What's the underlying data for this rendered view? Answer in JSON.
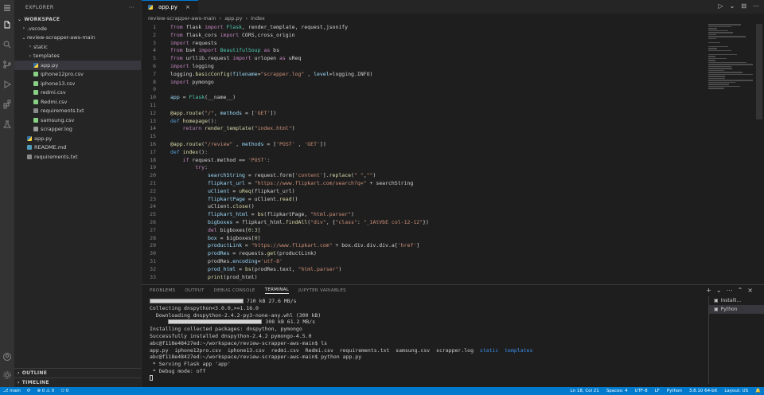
{
  "sidebar": {
    "title": "EXPLORER",
    "workspace": "WORKSPACE",
    "tree": [
      {
        "label": ".vscode",
        "indent": 1,
        "chev": ">",
        "icon": ""
      },
      {
        "label": "review-scrapper-aws-main",
        "indent": 1,
        "chev": "v",
        "icon": ""
      },
      {
        "label": "static",
        "indent": 2,
        "chev": ">",
        "icon": ""
      },
      {
        "label": "templates",
        "indent": 2,
        "chev": ">",
        "icon": ""
      },
      {
        "label": "app.py",
        "indent": 2,
        "chev": "",
        "icon": "py",
        "active": true
      },
      {
        "label": "iphone12pro.csv",
        "indent": 2,
        "chev": "",
        "icon": "csv"
      },
      {
        "label": "iphone13.csv",
        "indent": 2,
        "chev": "",
        "icon": "csv"
      },
      {
        "label": "redmi.csv",
        "indent": 2,
        "chev": "",
        "icon": "csv"
      },
      {
        "label": "Redmi.csv",
        "indent": 2,
        "chev": "",
        "icon": "csv"
      },
      {
        "label": "requirements.txt",
        "indent": 2,
        "chev": "",
        "icon": "txt"
      },
      {
        "label": "samsung.csv",
        "indent": 2,
        "chev": "",
        "icon": "csv"
      },
      {
        "label": "scrapper.log",
        "indent": 2,
        "chev": "",
        "icon": "log"
      },
      {
        "label": "app.py",
        "indent": 1,
        "chev": "",
        "icon": "py"
      },
      {
        "label": "README.md",
        "indent": 1,
        "chev": "",
        "icon": "md"
      },
      {
        "label": "requirements.txt",
        "indent": 1,
        "chev": "",
        "icon": "txt"
      }
    ],
    "outline": "OUTLINE",
    "timeline": "TIMELINE"
  },
  "editor": {
    "tab_label": "app.py",
    "tab_close": "×",
    "breadcrumbs": [
      "review-scrapper-aws-main",
      "›",
      "app.py",
      "›",
      "index"
    ],
    "actions": [
      "▷",
      "⌄",
      "⊟",
      "⋯"
    ],
    "lines": [
      {
        "n": "1",
        "html": "<span class='kw'>from</span> flask <span class='kw'>import</span> <span class='cl'>Flask</span>, render_template, request,jsonify"
      },
      {
        "n": "2",
        "html": "<span class='kw'>from</span> flask_cors <span class='kw'>import</span> CORS,cross_origin"
      },
      {
        "n": "3",
        "html": "<span class='kw'>import</span> requests"
      },
      {
        "n": "4",
        "html": "<span class='kw'>from</span> bs4 <span class='kw'>import</span> <span class='cl'>BeautifulSoup</span> <span class='kw'>as</span> bs"
      },
      {
        "n": "5",
        "html": "<span class='kw'>from</span> urllib.request <span class='kw'>import</span> urlopen <span class='kw'>as</span> uReq"
      },
      {
        "n": "6",
        "html": "<span class='kw'>import</span> logging"
      },
      {
        "n": "7",
        "html": "logging.<span class='fn'>basicConfig</span>(<span class='vr'>filename</span>=<span class='st'>\"scrapper.log\"</span> , <span class='vr'>level</span>=logging.INFO)"
      },
      {
        "n": "8",
        "html": "<span class='kw'>import</span> pymongo"
      },
      {
        "n": "9",
        "html": ""
      },
      {
        "n": "10",
        "html": "<span class='vr'>app</span> = <span class='cl'>Flask</span>(__name__)"
      },
      {
        "n": "11",
        "html": ""
      },
      {
        "n": "12",
        "html": "<span class='fn'>@app.route</span>(<span class='st'>\"/\"</span>, <span class='vr'>methods</span> = [<span class='st'>'GET'</span>])"
      },
      {
        "n": "13",
        "html": "<span class='bl'>def</span> <span class='fn'>homepage</span>():"
      },
      {
        "n": "14",
        "html": "    <span class='kw'>return</span> <span class='fn'>render_template</span>(<span class='st'>\"index.html\"</span>)"
      },
      {
        "n": "15",
        "html": ""
      },
      {
        "n": "16",
        "html": "<span class='fn'>@app.route</span>(<span class='st'>\"/review\"</span> , <span class='vr'>methods</span> = [<span class='st'>'POST'</span> , <span class='st'>'GET'</span>])"
      },
      {
        "n": "17",
        "html": "<span class='bl'>def</span> <span class='fn'>index</span>():"
      },
      {
        "n": "18",
        "html": "    <span class='kw'>if</span> request.method == <span class='st'>'POST'</span>:"
      },
      {
        "n": "19",
        "html": "        <span class='kw'>try</span>:"
      },
      {
        "n": "20",
        "html": "            <span class='vr'>searchString</span> = request.form[<span class='st'>'content'</span>].<span class='fn'>replace</span>(<span class='st'>\" \"</span>,<span class='st'>\"\"</span>)"
      },
      {
        "n": "21",
        "html": "            <span class='vr'>flipkart_url</span> = <span class='st'>\"https://www.flipkart.com/search?q=\"</span> + searchString"
      },
      {
        "n": "22",
        "html": "            <span class='vr'>uClient</span> = <span class='fn'>uReq</span>(flipkart_url)"
      },
      {
        "n": "23",
        "html": "            <span class='vr'>flipkartPage</span> = uClient.<span class='fn'>read</span>()"
      },
      {
        "n": "24",
        "html": "            uClient.<span class='fn'>close</span>()"
      },
      {
        "n": "25",
        "html": "            <span class='vr'>flipkart_html</span> = <span class='fn'>bs</span>(flipkartPage, <span class='st'>\"html.parser\"</span>)"
      },
      {
        "n": "26",
        "html": "            <span class='vr'>bigboxes</span> = flipkart_html.<span class='fn'>findAll</span>(<span class='st'>\"div\"</span>, {<span class='st'>\"class\"</span>: <span class='st'>\"_1AtVbE col-12-12\"</span>})"
      },
      {
        "n": "27",
        "html": "            <span class='kw'>del</span> bigboxes[<span class='nm'>0</span>:<span class='nm'>3</span>]"
      },
      {
        "n": "28",
        "html": "            <span class='vr'>box</span> = bigboxes[<span class='nm'>0</span>]"
      },
      {
        "n": "29",
        "html": "            <span class='vr'>productLink</span> = <span class='st'>\"https://www.flipkart.com\"</span> + box.div.div.div.a[<span class='st'>'href'</span>]"
      },
      {
        "n": "30",
        "html": "            <span class='vr'>prodRes</span> = requests.<span class='fn'>get</span>(productLink)"
      },
      {
        "n": "31",
        "html": "            prodRes.<span class='vr'>encoding</span>=<span class='st'>'utf-8'</span>"
      },
      {
        "n": "32",
        "html": "            <span class='vr'>prod_html</span> = <span class='fn'>bs</span>(prodRes.text, <span class='st'>\"html.parser\"</span>)"
      },
      {
        "n": "33",
        "html": "            <span class='fn'>print</span>(prod_html)"
      }
    ]
  },
  "panel": {
    "tabs": [
      "PROBLEMS",
      "OUTPUT",
      "DEBUG CONSOLE",
      "TERMINAL",
      "JUPYTER VARIABLES"
    ],
    "active_tab": "TERMINAL",
    "actions": [
      "+",
      "⌄",
      "⋯",
      "⌃",
      "×"
    ],
    "terminal_list": [
      {
        "label": "Installi...",
        "icon": "▣"
      },
      {
        "label": "Python",
        "icon": "▣",
        "active": true
      }
    ],
    "terminal": {
      "line1": "710 kB 27.6 MB/s",
      "line2": "Collecting dnspython<3.0.0,>=1.16.0",
      "line3": "  Downloading dnspython-2.4.2-py3-none-any.whl (300 kB)",
      "line4": "308 kB 61.2 MB/s",
      "line5": "Installing collected packages: dnspython, pymongo",
      "line6": "Successfully installed dnspython-2.4.2 pymongo-4.5.0",
      "prompt1": "abc@f118e48427ed:~/workspace/review-scrapper-aws-main$ ls",
      "ls_files": "app.py  iphone12pro.csv  iphone13.csv  redmi.csv  Redmi.csv  requirements.txt  samsung.csv  scrapper.log  ",
      "ls_dirs": "static  templates",
      "prompt2": "abc@f118e48427ed:~/workspace/review-scrapper-aws-main$ python app.py",
      "serve1": " * Serving Flask app 'app'",
      "serve2": " * Debug mode: off"
    }
  },
  "status": {
    "branch": "⎇ main",
    "sync": "⟳",
    "problems": "⊗ 0 ⚠ 0",
    "ports": "⚇ 0",
    "position": "Ln 18, Col 21",
    "spaces": "Spaces: 4",
    "encoding": "UTF-8",
    "eol": "LF",
    "language": "Python",
    "interpreter": "3.8.10 64-bit",
    "layout": "Layout: US",
    "bell": "🔔"
  },
  "colors": {
    "accent": "#007acc",
    "editor_bg": "#1e1e1e",
    "sidebar_bg": "#252526"
  }
}
